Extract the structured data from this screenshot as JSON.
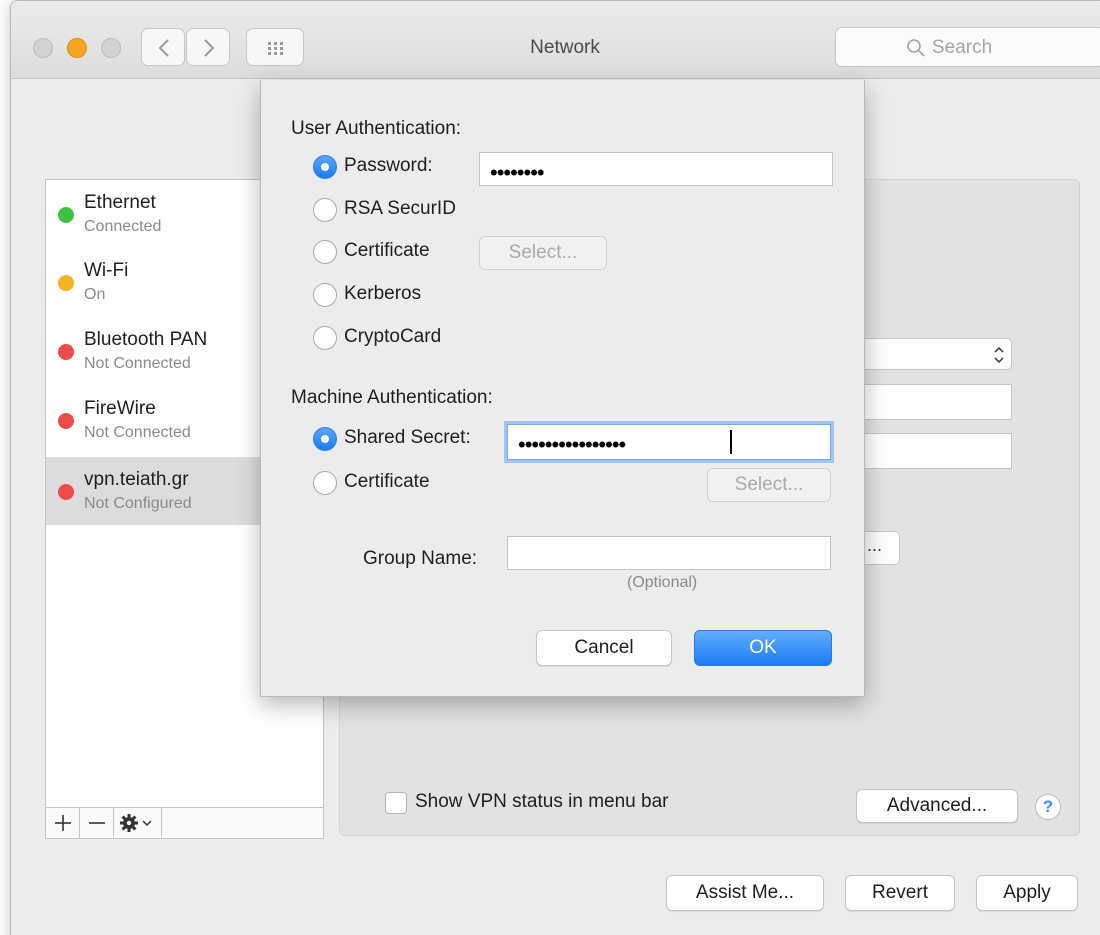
{
  "window": {
    "title": "Network"
  },
  "toolbar": {
    "search_placeholder": "Search"
  },
  "sidebar": {
    "services": [
      {
        "name": "Ethernet",
        "status": "Connected",
        "color": "#3ec33e"
      },
      {
        "name": "Wi-Fi",
        "status": "On",
        "color": "#f5b323"
      },
      {
        "name": "Bluetooth PAN",
        "status": "Not Connected",
        "color": "#f04b4b"
      },
      {
        "name": "FireWire",
        "status": "Not Connected",
        "color": "#f04b4b"
      },
      {
        "name": "vpn.teiath.gr",
        "status": "Not Configured",
        "color": "#f04b4b"
      }
    ],
    "tools": {
      "add": "+",
      "remove": "−"
    }
  },
  "main": {
    "show_vpn_status_label": "Show VPN status in menu bar",
    "advanced_label": "Advanced...",
    "help_label": "?",
    "partial_button_label": "..."
  },
  "footer": {
    "assist_label": "Assist Me...",
    "revert_label": "Revert",
    "apply_label": "Apply"
  },
  "sheet": {
    "user_auth": {
      "heading": "User Authentication:",
      "options": [
        "Password:",
        "RSA SecurID",
        "Certificate",
        "Kerberos",
        "CryptoCard"
      ],
      "selected": "Password:",
      "password_value": "••••••••",
      "select_label": "Select..."
    },
    "machine_auth": {
      "heading": "Machine Authentication:",
      "options": [
        "Shared Secret:",
        "Certificate"
      ],
      "selected": "Shared Secret:",
      "shared_secret_value": "••••••••••••••••",
      "select_label": "Select..."
    },
    "group_name": {
      "label": "Group Name:",
      "value": "",
      "hint": "(Optional)"
    },
    "cancel_label": "Cancel",
    "ok_label": "OK"
  },
  "colors": {
    "accent": "#1d7af2"
  }
}
